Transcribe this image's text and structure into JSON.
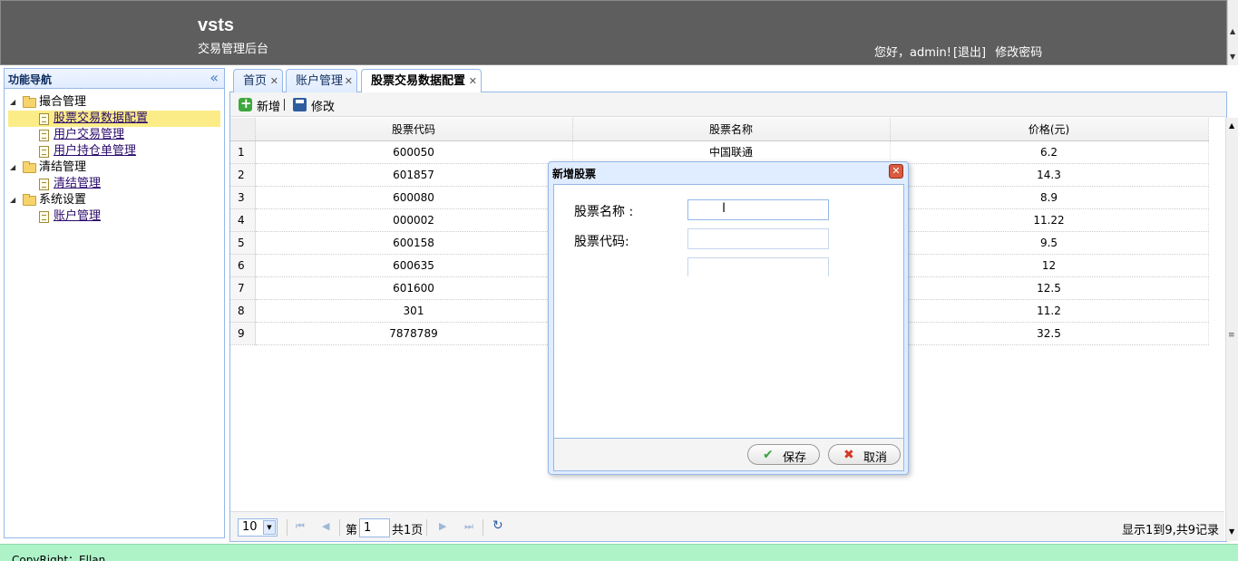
{
  "header": {
    "app_title": "vsts",
    "app_subtitle": "交易管理后台",
    "greeting": "您好，admin!",
    "logout": "[退出]",
    "change_password": "修改密码"
  },
  "sidebar": {
    "title": "功能导航",
    "collapse_glyph": "«",
    "groups": [
      {
        "label": "撮合管理",
        "items": [
          "股票交易数据配置",
          "用户交易管理",
          "用户持仓单管理"
        ]
      },
      {
        "label": "清结管理",
        "items": [
          "清结管理"
        ]
      },
      {
        "label": "系统设置",
        "items": [
          "账户管理"
        ]
      }
    ]
  },
  "tabs": [
    {
      "label": "首页"
    },
    {
      "label": "账户管理"
    },
    {
      "label": "股票交易数据配置"
    }
  ],
  "toolbar": {
    "add_label": "新增",
    "edit_label": "修改"
  },
  "grid": {
    "columns": [
      "股票代码",
      "股票名称",
      "价格(元)"
    ],
    "rows": [
      {
        "n": "1",
        "code": "600050",
        "name": "中国联通",
        "price": "6.2"
      },
      {
        "n": "2",
        "code": "601857",
        "name": "",
        "price": "14.3"
      },
      {
        "n": "3",
        "code": "600080",
        "name": "",
        "price": "8.9"
      },
      {
        "n": "4",
        "code": "000002",
        "name": "",
        "price": "11.22"
      },
      {
        "n": "5",
        "code": "600158",
        "name": "",
        "price": "9.5"
      },
      {
        "n": "6",
        "code": "600635",
        "name": "",
        "price": "12"
      },
      {
        "n": "7",
        "code": "601600",
        "name": "",
        "price": "12.5"
      },
      {
        "n": "8",
        "code": "301",
        "name": "",
        "price": "11.2"
      },
      {
        "n": "9",
        "code": "7878789",
        "name": "",
        "price": "32.5"
      }
    ]
  },
  "pager": {
    "page_size": "10",
    "page_label": "第",
    "current_page": "1",
    "total_pages": "共1页",
    "info": "显示1到9,共9记录"
  },
  "dialog": {
    "title": "新增股票",
    "fields": [
      {
        "label": "股票名称 :",
        "value": ""
      },
      {
        "label": "股票代码:",
        "value": ""
      }
    ],
    "save_label": "保存",
    "cancel_label": "取消"
  },
  "footer": {
    "copyright": "CopyRight：Ellan"
  }
}
